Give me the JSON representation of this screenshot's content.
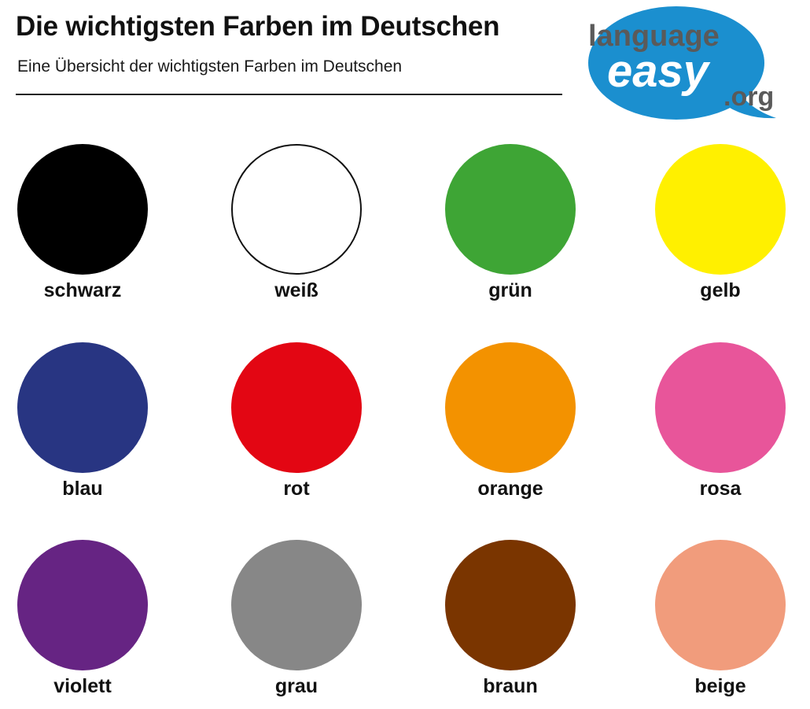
{
  "header": {
    "title": "Die wichtigsten Farben im Deutschen",
    "subtitle": "Eine Übersicht der wichtigsten Farben im Deutschen"
  },
  "logo": {
    "line1": "language",
    "line2": "easy",
    "line3": ".org",
    "bubble_color": "#1b8fcf",
    "text_color": "#ffffff",
    "accent_color": "#5a5a5a"
  },
  "colors": [
    {
      "label": "schwarz",
      "hex": "#000000",
      "outlined": false
    },
    {
      "label": "weiß",
      "hex": "#ffffff",
      "outlined": true
    },
    {
      "label": "grün",
      "hex": "#3ea535",
      "outlined": false
    },
    {
      "label": "gelb",
      "hex": "#fff000",
      "outlined": false
    },
    {
      "label": "blau",
      "hex": "#283582",
      "outlined": false
    },
    {
      "label": "rot",
      "hex": "#e30613",
      "outlined": false
    },
    {
      "label": "orange",
      "hex": "#f39200",
      "outlined": false
    },
    {
      "label": "rosa",
      "hex": "#e8559a",
      "outlined": false
    },
    {
      "label": "violett",
      "hex": "#662483",
      "outlined": false
    },
    {
      "label": "grau",
      "hex": "#878787",
      "outlined": false
    },
    {
      "label": "braun",
      "hex": "#7a3500",
      "outlined": false
    },
    {
      "label": "beige",
      "hex": "#f19c7c",
      "outlined": false
    }
  ]
}
